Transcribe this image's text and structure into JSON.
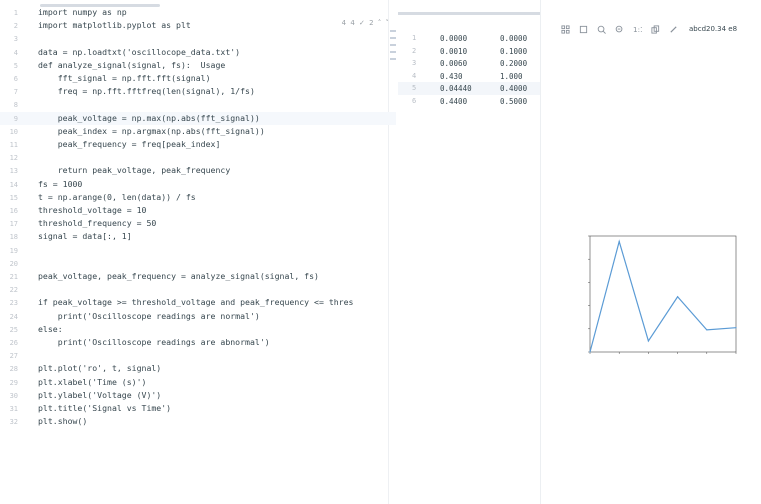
{
  "editor": {
    "lines": [
      {
        "n": "1",
        "text": "import numpy as np"
      },
      {
        "n": "2",
        "text": "import matplotlib.pyplot as plt"
      },
      {
        "n": "3",
        "text": ""
      },
      {
        "n": "4",
        "text": "data = np.loadtxt('oscillocope_data.txt')"
      },
      {
        "n": "5",
        "text": "def analyze_signal(signal, fs):  Usage"
      },
      {
        "n": "6",
        "text": "    fft_signal = np.fft.fft(signal)"
      },
      {
        "n": "7",
        "text": "    freq = np.fft.fftfreq(len(signal), 1/fs)"
      },
      {
        "n": "8",
        "text": ""
      },
      {
        "n": "9",
        "text": "    peak_voltage = np.max(np.abs(fft_signal))"
      },
      {
        "n": "10",
        "text": "    peak_index = np.argmax(np.abs(fft_signal))"
      },
      {
        "n": "11",
        "text": "    peak_frequency = freq[peak_index]"
      },
      {
        "n": "12",
        "text": ""
      },
      {
        "n": "13",
        "text": "    return peak_voltage, peak_frequency"
      },
      {
        "n": "14",
        "text": "fs = 1000"
      },
      {
        "n": "15",
        "text": "t = np.arange(0, len(data)) / fs"
      },
      {
        "n": "16",
        "text": "threshold_voltage = 10"
      },
      {
        "n": "17",
        "text": "threshold_frequency = 50"
      },
      {
        "n": "18",
        "text": "signal = data[:, 1]"
      },
      {
        "n": "19",
        "text": ""
      },
      {
        "n": "20",
        "text": ""
      },
      {
        "n": "21",
        "text": "peak_voltage, peak_frequency = analyze_signal(signal, fs)"
      },
      {
        "n": "22",
        "text": ""
      },
      {
        "n": "23",
        "text": "if peak_voltage >= threshold_voltage and peak_frequency <= thres"
      },
      {
        "n": "24",
        "text": "    print('Oscillosсope readings are normal')"
      },
      {
        "n": "25",
        "text": "else:"
      },
      {
        "n": "26",
        "text": "    print('Oscilloscope readings are abnormal')"
      },
      {
        "n": "27",
        "text": ""
      },
      {
        "n": "28",
        "text": "plt.plot('ro', t, signal)"
      },
      {
        "n": "29",
        "text": "plt.xlabel('Time (s)')"
      },
      {
        "n": "30",
        "text": "plt.ylabel('Voltage (V)')"
      },
      {
        "n": "31",
        "text": "plt.title('Signal vs Time')"
      },
      {
        "n": "32",
        "text": "plt.show()"
      }
    ],
    "toolbar_text": "4 4 ✓ 2 ˄ ˅"
  },
  "output": {
    "rows": [
      {
        "idx": "1",
        "c1": "0.0000",
        "c2": "0.0000"
      },
      {
        "idx": "2",
        "c1": "0.0010",
        "c2": "0.1000"
      },
      {
        "idx": "3",
        "c1": "0.0060",
        "c2": "0.2000"
      },
      {
        "idx": "4",
        "c1": "0.430",
        "c2": "1.000"
      },
      {
        "idx": "5",
        "c1": "0.04440",
        "c2": "0.4000"
      },
      {
        "idx": "6",
        "c1": "0.4400",
        "c2": "0.5000"
      }
    ]
  },
  "plot_toolbar": {
    "filename": "abcd20.34 e8"
  },
  "colors": {
    "line": "#5b9bd5",
    "code_text": "#37474f",
    "gutter_text": "#c0c5cc"
  },
  "chart_data": {
    "type": "line",
    "title": "",
    "xlabel": "",
    "ylabel": "",
    "x": [
      0.0,
      1.0,
      2.0,
      3.0,
      4.0,
      5.0
    ],
    "series": [
      {
        "values": [
          0.0,
          1.0,
          0.1,
          0.5,
          0.2,
          0.22
        ]
      }
    ],
    "xlim": [
      0.0,
      5.0
    ],
    "ylim": [
      0.0,
      1.05
    ],
    "grid": false
  }
}
